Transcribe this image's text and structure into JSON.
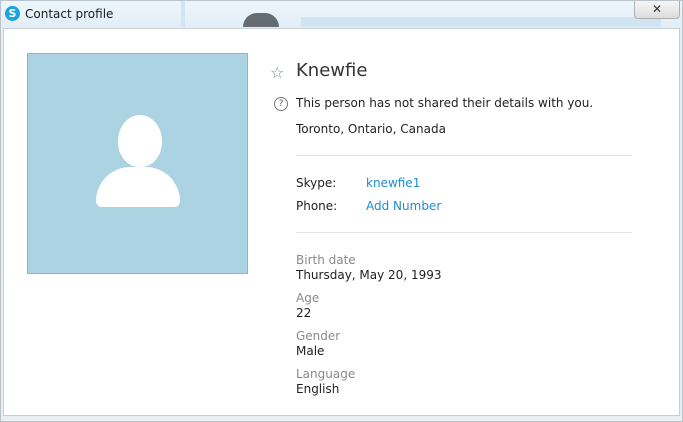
{
  "window": {
    "title": "Contact profile",
    "app_icon_glyph": "S",
    "close_glyph": "✕"
  },
  "profile": {
    "name": "Knewfie",
    "notice": "This person has not shared their details with you.",
    "location": "Toronto, Ontario, Canada",
    "skype_label": "Skype:",
    "skype_value": "knewfie1",
    "phone_label": "Phone:",
    "phone_action": "Add Number",
    "birth_label": "Birth date",
    "birth_value": "Thursday, May 20, 1993",
    "age_label": "Age",
    "age_value": "22",
    "gender_label": "Gender",
    "gender_value": "Male",
    "language_label": "Language",
    "language_value": "English"
  },
  "icons": {
    "star": "☆",
    "help": "?"
  },
  "colors": {
    "accent_link": "#1a8fd0",
    "avatar_bg": "#acd3e1"
  }
}
